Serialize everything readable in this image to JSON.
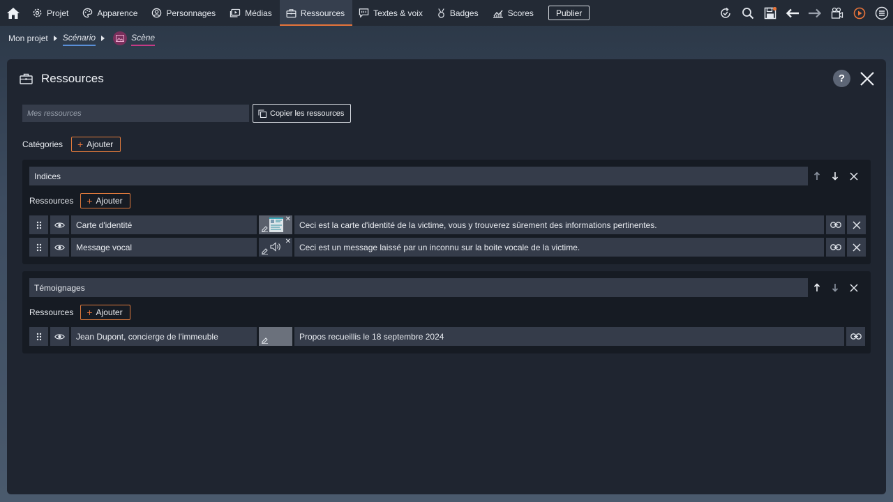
{
  "nav": {
    "items": [
      {
        "label": "Projet",
        "icon": "gear-icon"
      },
      {
        "label": "Apparence",
        "icon": "palette-icon"
      },
      {
        "label": "Personnages",
        "icon": "user-circle-icon"
      },
      {
        "label": "Médias",
        "icon": "media-icon"
      },
      {
        "label": "Ressources",
        "icon": "briefcase-icon",
        "active": true
      },
      {
        "label": "Textes & voix",
        "icon": "speech-bubble-icon"
      },
      {
        "label": "Badges",
        "icon": "badge-icon"
      },
      {
        "label": "Scores",
        "icon": "chart-icon"
      }
    ],
    "publish_label": "Publier",
    "accent": "#e8743a"
  },
  "breadcrumb": {
    "root": "Mon projet",
    "scenario": "Scénario",
    "scene": "Scène"
  },
  "panel": {
    "title": "Ressources",
    "help_label": "?",
    "resources_placeholder": "Mes ressources",
    "copy_label": "Copier les ressources",
    "categories_label": "Catégories",
    "add_label": "Ajouter"
  },
  "categories": [
    {
      "name": "Indices",
      "resources_label": "Ressources",
      "add_label": "Ajouter",
      "items": [
        {
          "name": "Carte d'identité",
          "media": "image",
          "description": "Ceci est la carte d'identité de la victime, vous y trouverez sûrement des informations pertinentes."
        },
        {
          "name": "Message vocal",
          "media": "audio",
          "description": "Ceci est un message laissé par un inconnu sur la boite vocale de la victime."
        }
      ]
    },
    {
      "name": "Témoignages",
      "resources_label": "Ressources",
      "add_label": "Ajouter",
      "items": [
        {
          "name": "Jean Dupont, concierge de l'immeuble",
          "media": "none",
          "description": "Propos recueillis le 18 septembre 2024"
        }
      ]
    }
  ]
}
